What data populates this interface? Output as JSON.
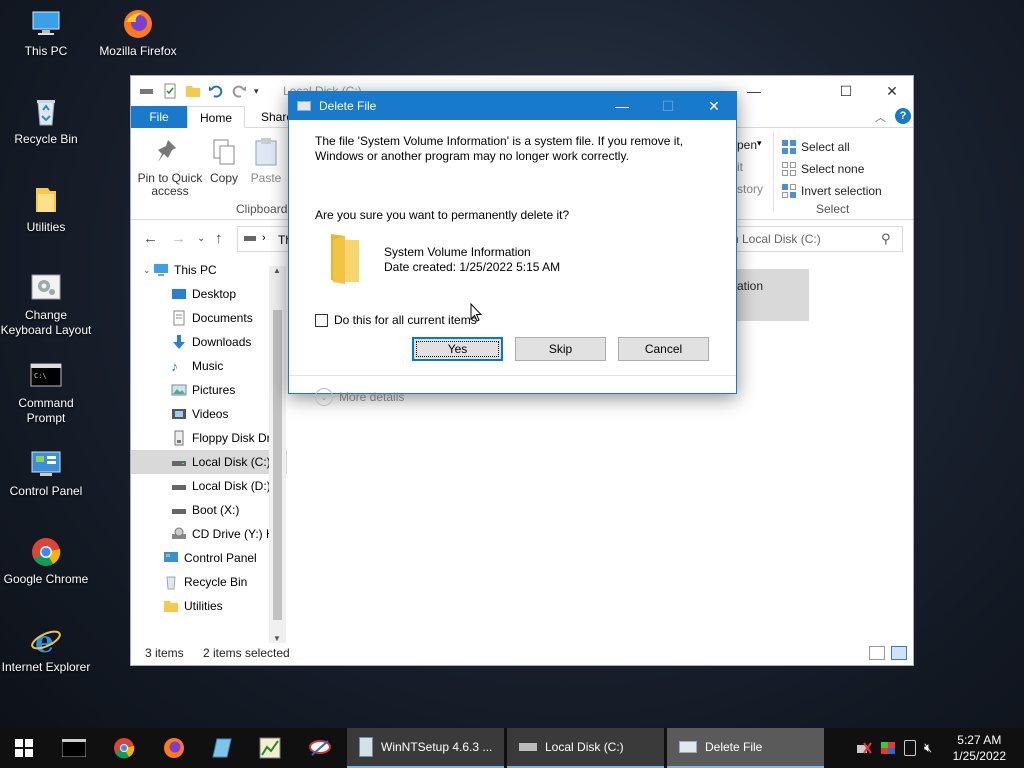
{
  "desktop": {
    "icons": [
      {
        "label": "This PC"
      },
      {
        "label": "Mozilla Firefox"
      },
      {
        "label": "Recycle Bin"
      },
      {
        "label": "Utilities"
      },
      {
        "label": "Change Keyboard Layout"
      },
      {
        "label": "Command Prompt"
      },
      {
        "label": "Control Panel"
      },
      {
        "label": "Google Chrome"
      },
      {
        "label": "Internet Explorer"
      }
    ]
  },
  "explorer": {
    "title": "Local Disk (C:)",
    "tabs": {
      "file": "File",
      "home": "Home",
      "share": "Share"
    },
    "ribbon": {
      "pin_label": "Pin to Quick access",
      "copy_label": "Copy",
      "paste_label": "Paste",
      "clipboard_group": "Clipboard",
      "open_partial": "pen",
      "edit_partial": "it",
      "history_partial": "story",
      "select_all": "Select all",
      "select_none": "Select none",
      "invert_selection": "Invert selection",
      "select_group": "Select"
    },
    "address": {
      "partial": "Th",
      "search_placeholder": "h Local Disk (C:)"
    },
    "nav": [
      {
        "label": "This PC"
      },
      {
        "label": "Desktop"
      },
      {
        "label": "Documents"
      },
      {
        "label": "Downloads"
      },
      {
        "label": "Music"
      },
      {
        "label": "Pictures"
      },
      {
        "label": "Videos"
      },
      {
        "label": "Floppy Disk Dri"
      },
      {
        "label": "Local Disk (C:)"
      },
      {
        "label": "Local Disk (D:)"
      },
      {
        "label": "Boot (X:)"
      },
      {
        "label": "CD Drive (Y:) H"
      },
      {
        "label": "Control Panel"
      },
      {
        "label": "Recycle Bin"
      },
      {
        "label": "Utilities"
      }
    ],
    "content_item_partial": "ation",
    "status": {
      "items": "3 items",
      "selected": "2 items selected"
    }
  },
  "dialog": {
    "title": "Delete File",
    "message": "The file 'System Volume Information' is a system file. If you remove it, Windows or another program may no longer work correctly.",
    "question": "Are you sure you want to permanently delete it?",
    "file_name": "System Volume Information",
    "file_date": "Date created: 1/25/2022 5:15 AM",
    "checkbox_label": "Do this for all current items",
    "yes": "Yes",
    "skip": "Skip",
    "cancel": "Cancel",
    "more_details": "More details"
  },
  "taskbar": {
    "apps": [
      {
        "label": "WinNTSetup 4.6.3 ..."
      },
      {
        "label": "Local Disk (C:)"
      },
      {
        "label": "Delete File"
      }
    ],
    "time": "5:27 AM",
    "date": "1/25/2022"
  },
  "colors": {
    "accent": "#1979ca",
    "selection": "#d9d9d9",
    "taskbar": "#101010"
  }
}
